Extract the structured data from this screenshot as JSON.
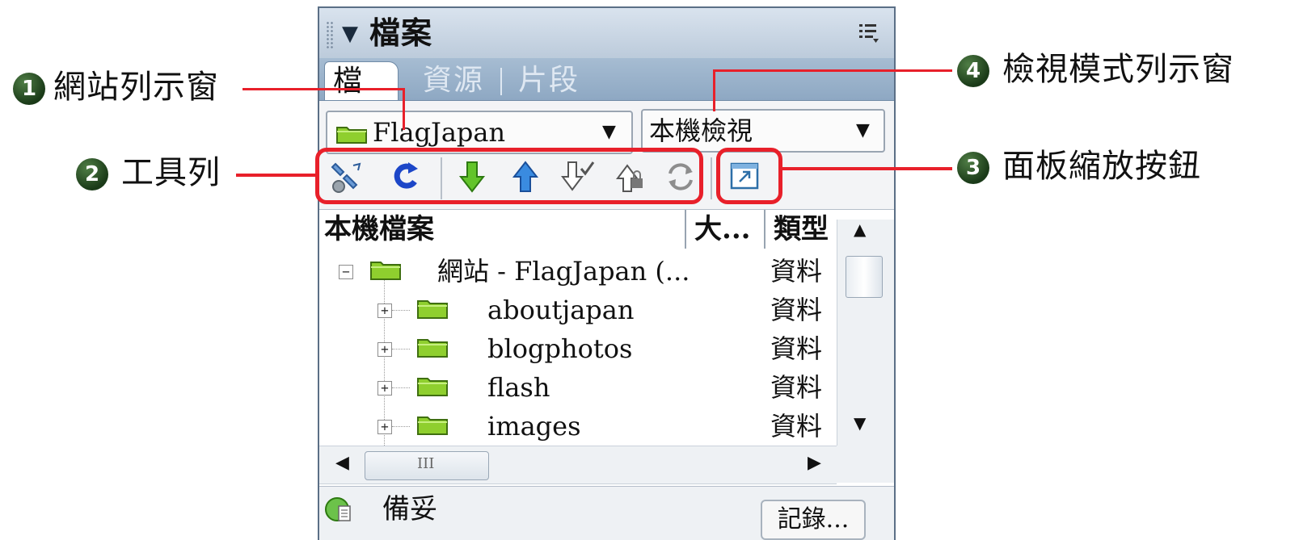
{
  "panel": {
    "title": "檔案",
    "tabs": [
      "檔案",
      "資源",
      "片段"
    ],
    "site_select": {
      "value": "FlagJapan"
    },
    "view_select": {
      "value": "本機檢視"
    },
    "toolbar": {
      "icons": [
        "connect-icon",
        "refresh-icon",
        "get-files-icon",
        "put-files-icon",
        "check-out-icon",
        "check-in-icon",
        "synchronize-icon",
        "expand-collapse-icon"
      ]
    },
    "columns": {
      "local": "本機檔案",
      "size": "大...",
      "type": "類型"
    },
    "rows": [
      {
        "name": "網站 - FlagJapan (...",
        "type": "資料"
      },
      {
        "name": "aboutjapan",
        "type": "資料"
      },
      {
        "name": "blogphotos",
        "type": "資料"
      },
      {
        "name": "flash",
        "type": "資料"
      },
      {
        "name": "images",
        "type": "資料"
      }
    ],
    "status": {
      "text": "備妥",
      "log_button": "記錄..."
    },
    "hscroll_grip": "III"
  },
  "callouts": [
    {
      "number": "1",
      "label": "網站列示窗"
    },
    {
      "number": "2",
      "label": "工具列"
    },
    {
      "number": "3",
      "label": "面板縮放按鈕"
    },
    {
      "number": "4",
      "label": "檢視模式列示窗"
    }
  ],
  "colors": {
    "highlight": "#e8202a",
    "badge": "#2c5426",
    "tab_bar": "#9bb3cc",
    "folder": "#8fcf2e"
  }
}
